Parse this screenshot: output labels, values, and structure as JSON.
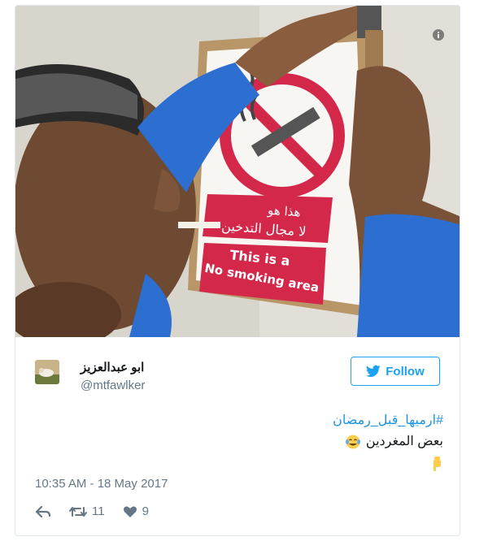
{
  "tweet": {
    "display_name": "ابو عبدالعزيز",
    "handle": "@mtfawlker",
    "follow_label": "Follow",
    "hashtag": "#ارميها_قبل_رمضان",
    "text_line": "بعض المغردين",
    "timestamp": "10:35 AM - 18 May 2017",
    "retweets": "11",
    "likes": "9"
  },
  "photo": {
    "sign_arabic_line1": "هذا هو",
    "sign_arabic_line2": "لا مجال التدخين",
    "sign_english_line1": "This is a",
    "sign_english_line2": "No smoking area"
  },
  "icons": {
    "info": "info-icon",
    "twitter_bird": "twitter-bird-icon",
    "reply": "reply-icon",
    "retweet": "retweet-icon",
    "like": "heart-icon",
    "emoji_laugh": "face-with-tears-of-joy-icon",
    "emoji_point": "backhand-index-pointing-down-icon"
  },
  "colors": {
    "accent": "#1da1f2",
    "hashtag": "#1b95e0",
    "secondary_text": "#657786",
    "sign_red": "#d4284a"
  }
}
